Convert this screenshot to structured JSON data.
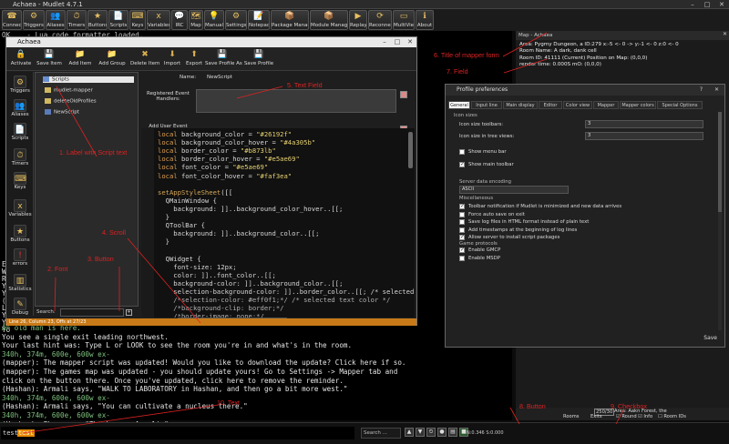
{
  "window": {
    "title": "Achaea - Mudlet 4.7.1",
    "buttons": [
      "–",
      "□",
      "✕"
    ]
  },
  "main_toolbar": [
    {
      "label": "Connect",
      "icon": "☎"
    },
    {
      "label": "Triggers",
      "icon": "⚙"
    },
    {
      "label": "Aliases",
      "icon": "👥"
    },
    {
      "label": "Timers",
      "icon": "⏱"
    },
    {
      "label": "Buttons",
      "icon": "★"
    },
    {
      "label": "Scripts",
      "icon": "📄"
    },
    {
      "label": "Keys",
      "icon": "⌨"
    },
    {
      "label": "Variables",
      "icon": "x"
    },
    {
      "label": "IRC",
      "icon": "💬"
    },
    {
      "label": "Map",
      "icon": "🗺"
    },
    {
      "label": "Manual",
      "icon": "💡"
    },
    {
      "label": "Settings",
      "icon": "⚙"
    },
    {
      "label": "Notepad",
      "icon": "📝"
    },
    {
      "label": "Package Manager",
      "icon": "📦"
    },
    {
      "label": "Module Manager",
      "icon": "📦"
    },
    {
      "label": "Replay",
      "icon": "▶"
    },
    {
      "label": "Reconnect",
      "icon": "⟳"
    },
    {
      "label": "MultiView",
      "icon": "▭"
    },
    {
      "label": "About",
      "icon": "ℹ"
    }
  ],
  "console_lines": [
    {
      "text": "OK    - Lua code formatter loaded.",
      "cls": "c-grey"
    },
    {
      "text": "An old man is here.",
      "cls": "c-green"
    },
    {
      "text": "You see a single exit leading northwest.",
      "cls": "c-white"
    },
    {
      "text": "Your last hint was: Type L or LOOK to see the room you're in and what's in the room.",
      "cls": "c-white"
    },
    {
      "text": "340h, 374m, 600e, 600w ex-",
      "cls": "c-green"
    },
    {
      "text": "(mapper): The mapper script was updated! Would you like to download the update? Click here if so.",
      "cls": "c-white"
    },
    {
      "text": "(mapper): The games map was updated - you should update yours! Go to Settings -> Mapper tab and",
      "cls": "c-white"
    },
    {
      "text": "click on the button there. Once you've updated, click here to remove the reminder.",
      "cls": "c-white"
    },
    {
      "text": "(Hashan): Armali says, \"WALK TO LABORATORY in Hashan, and then go a bit more west.\"",
      "cls": "c-white"
    },
    {
      "text": "340h, 374m, 600e, 600w ex-",
      "cls": "c-green"
    },
    {
      "text": "(Hashan): Armali says, \"You can cultivate a nucleus there.\"",
      "cls": "c-white"
    },
    {
      "text": "340h, 374m, 600e, 600w ex-",
      "cls": "c-green"
    },
    {
      "text": "(Hashan): Eba says, \"Thank you, Armali.\"",
      "cls": "c-white"
    },
    {
      "text": "340h, 374m, 600e, 600w ex-",
      "cls": "c-green"
    }
  ],
  "console_left_stub": [
    "Er",
    "Wh",
    "Ro",
    "Yo",
    "Yo",
    "(",
    "Lo",
    "Yo",
    "Yo",
    "Yo"
  ],
  "script_window": {
    "title": "Achaea",
    "toolbar": [
      {
        "label": "Activate",
        "icon": "🔒"
      },
      {
        "label": "Save Item",
        "icon": "💾"
      },
      {
        "label": "Add Item",
        "icon": "📁"
      },
      {
        "label": "Add Group",
        "icon": "📁"
      },
      {
        "label": "Delete Item",
        "icon": "✖"
      },
      {
        "label": "Import",
        "icon": "⬇"
      },
      {
        "label": "Export",
        "icon": "⬆"
      },
      {
        "label": "Save Profile As",
        "icon": "💾"
      },
      {
        "label": "Save Profile",
        "icon": "💾"
      }
    ],
    "sidebar": [
      {
        "label": "Triggers",
        "icon": "⚙"
      },
      {
        "label": "Aliases",
        "icon": "👥"
      },
      {
        "label": "Scripts",
        "icon": "📄"
      },
      {
        "label": "Timers",
        "icon": "⏱"
      },
      {
        "label": "Keys",
        "icon": "⌨"
      },
      {
        "label": "Variables",
        "icon": "x"
      },
      {
        "label": "Buttons",
        "icon": "★"
      },
      {
        "label": "errors",
        "icon": "!"
      },
      {
        "label": "Statistics",
        "icon": "▥"
      },
      {
        "label": "Debug",
        "icon": "✎"
      }
    ],
    "tree": [
      {
        "label": "Scripts",
        "depth": 0
      },
      {
        "label": "mudlet-mapper",
        "depth": 1
      },
      {
        "label": "deleteOldProfiles",
        "depth": 1
      },
      {
        "label": "NewScript",
        "depth": 1
      }
    ],
    "search_label": "Search:",
    "name_label": "Name:",
    "name_value": "NewScript",
    "registered_label": "Registered Event Handlers:",
    "user_event_label": "Add User Event Handler:",
    "code_lines": [
      [
        [
          "k-kw",
          "local "
        ],
        [
          "k-id",
          "background_color = "
        ],
        [
          "k-str",
          "\"#26192f\""
        ]
      ],
      [
        [
          "k-kw",
          "local "
        ],
        [
          "k-id",
          "background_color_hover = "
        ],
        [
          "k-str",
          "\"#4a305b\""
        ]
      ],
      [
        [
          "k-kw",
          "local "
        ],
        [
          "k-id",
          "border_color = "
        ],
        [
          "k-str",
          "\"#b873lb\""
        ]
      ],
      [
        [
          "k-kw",
          "local "
        ],
        [
          "k-id",
          "border_color_hover = "
        ],
        [
          "k-str",
          "\"#e5ae69\""
        ]
      ],
      [
        [
          "k-kw",
          "local "
        ],
        [
          "k-id",
          "font_color = "
        ],
        [
          "k-str",
          "\"#e5ae69\""
        ]
      ],
      [
        [
          "k-kw",
          "local "
        ],
        [
          "k-id",
          "font_color_hover = "
        ],
        [
          "k-str",
          "\"#faf3ea\""
        ]
      ],
      [
        [
          "k-id",
          ""
        ]
      ],
      [
        [
          "k-fn",
          "setAppStyleSheet"
        ],
        [
          "k-br",
          "([["
        ]
      ],
      [
        [
          "k-id",
          "  QMainWindow {"
        ]
      ],
      [
        [
          "k-id",
          "    background: ]].."
        ],
        [
          "k-id",
          "background_color_hover"
        ],
        [
          "k-id",
          "..[[;"
        ]
      ],
      [
        [
          "k-id",
          "  }"
        ]
      ],
      [
        [
          "k-id",
          "  QToolBar {"
        ]
      ],
      [
        [
          "k-id",
          "    background: ]].."
        ],
        [
          "k-id",
          "background_color"
        ],
        [
          "k-id",
          "..[[;"
        ]
      ],
      [
        [
          "k-id",
          "  }"
        ]
      ],
      [
        [
          "k-id",
          ""
        ]
      ],
      [
        [
          "k-id",
          "  QWidget {"
        ]
      ],
      [
        [
          "k-id",
          "    font-size: 12px;"
        ]
      ],
      [
        [
          "k-id",
          "    color: ]].."
        ],
        [
          "k-id",
          "font_color"
        ],
        [
          "k-id",
          "..[[;"
        ]
      ],
      [
        [
          "k-id",
          "    background-color: ]].."
        ],
        [
          "k-id",
          "background_color"
        ],
        [
          "k-id",
          "..[[;"
        ]
      ],
      [
        [
          "k-id",
          "    selection-background-color: ]].."
        ],
        [
          "k-id",
          "border_color"
        ],
        [
          "k-id",
          "..[[; /* selected t"
        ]
      ],
      [
        [
          "k-cm",
          "    /*selection-color: #eff0f1;*/ /* selected text color */"
        ]
      ],
      [
        [
          "k-cm",
          "    /*background-clip: border;*/"
        ]
      ],
      [
        [
          "k-cm",
          "    /*border-image: none;*/"
        ]
      ]
    ],
    "status_text": "Line 26, Column 23, Offs at 27/23"
  },
  "mapper": {
    "title": "Map - Achaea",
    "info": [
      "Area: Pygmy Dungeon, a ID:279 x:-5 <- 0 -> y:-1 <- 0 z:0 <- 0",
      "Room Name: A dark, dank cell",
      "Room ID: 41111 (Current) Position on Map: (0,0,0)",
      "render time: 0.000S mO: (0,0,0)"
    ],
    "bottom": {
      "count": "250/30",
      "area": "Area: Aakn Forest, the",
      "rooms": "Rooms",
      "exits": "Exits",
      "round": "Round",
      "info": "Info",
      "room_ids": "Room IDs"
    }
  },
  "prefs": {
    "title": "Profile preferences",
    "tabs": [
      "General",
      "Input line",
      "Main display",
      "Editor",
      "Color view",
      "Mapper",
      "Mapper colors",
      "Special Options"
    ],
    "icon_sizes": "Icon sizes",
    "toolbar_size_label": "Icon size toolbars:",
    "toolbar_size_value": "3",
    "tree_size_label": "Icon size in tree views:",
    "tree_size_value": "3",
    "show_menu_bar": "Show menu bar",
    "show_main_toolbar": "Show main toolbar",
    "server_data_label": "Server data encoding",
    "encoding_value": "ASCII",
    "misc_label": "Miscellaneous",
    "options": [
      {
        "label": "Toolbar notification if Mudlet is minimized and new data arrives",
        "on": true
      },
      {
        "label": "Force auto save on exit",
        "on": false
      },
      {
        "label": "Save log files in HTML format instead of plain text",
        "on": false
      },
      {
        "label": "Add timestamps at the beginning of log lines",
        "on": false
      },
      {
        "label": "Allow server to install script packages",
        "on": true
      }
    ],
    "game_protocols": "Game protocols",
    "gmcp": "Enable GMCP",
    "msdp": "Enable MSDP",
    "save": "Save"
  },
  "input": {
    "prompt": "test",
    "typed": "test",
    "search_placeholder": "Search ...",
    "latency": "N:0.346 S:0.000"
  },
  "annotations": [
    "1. Label with Script text",
    "2. Font",
    "3. Button",
    "4. Scroll",
    "5. Text Field",
    "6. Title of mapper form",
    "7. Field",
    "8. Button",
    "9. Checkbox",
    "10. Text"
  ],
  "colors": {
    "status_orange": "#c87a18",
    "annotation_red": "#dd2222",
    "console_green": "#7fc27f"
  }
}
